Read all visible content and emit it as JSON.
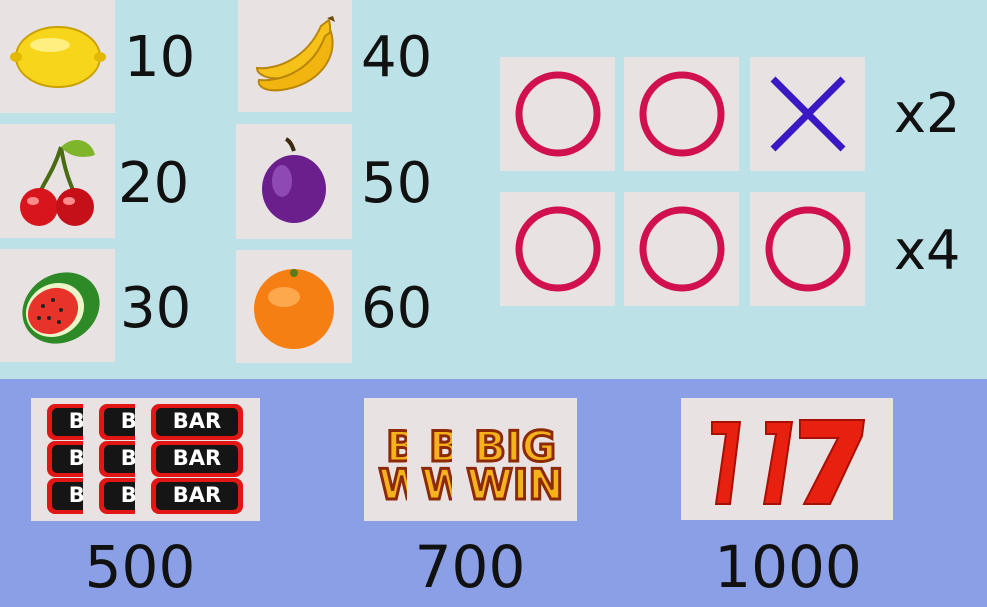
{
  "fruit_paytable": [
    {
      "symbol": "lemon-icon",
      "payout": "10"
    },
    {
      "symbol": "cherry-icon",
      "payout": "20"
    },
    {
      "symbol": "watermelon-icon",
      "payout": "30"
    },
    {
      "symbol": "banana-icon",
      "payout": "40"
    },
    {
      "symbol": "plum-icon",
      "payout": "50"
    },
    {
      "symbol": "orange-icon",
      "payout": "60"
    }
  ],
  "multiplier_rows": [
    {
      "marks": [
        "O",
        "O",
        "X"
      ],
      "label": "x2"
    },
    {
      "marks": [
        "O",
        "O",
        "O"
      ],
      "label": "x4"
    }
  ],
  "special_paytable": [
    {
      "symbol": "bar-icon",
      "tile_text": "BAR",
      "payout": "500"
    },
    {
      "symbol": "big-win-icon",
      "tile_text": "BIG WIN",
      "payout": "700"
    },
    {
      "symbol": "seven-icon",
      "tile_text": "7",
      "payout": "1000"
    }
  ],
  "colors": {
    "top_background": "#bce1e6",
    "bottom_background": "#8b9fe6",
    "tile_background": "#e9e2e3",
    "circle_mark": "#d0104f",
    "cross_mark": "#3a19c4"
  }
}
